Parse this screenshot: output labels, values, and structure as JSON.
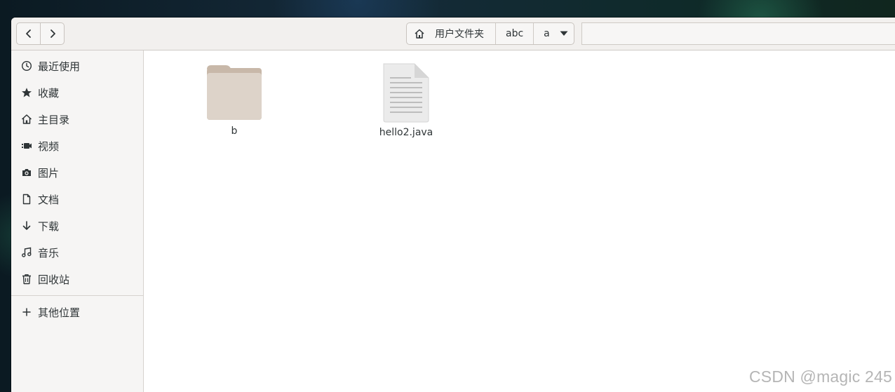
{
  "nav": {
    "back_icon": "chevron-left-icon",
    "forward_icon": "chevron-right-icon"
  },
  "pathbar": {
    "home_label": "用户文件夹",
    "crumbs": [
      "abc",
      "a"
    ]
  },
  "sidebar": {
    "items": [
      {
        "label": "最近使用",
        "icon": "clock-icon"
      },
      {
        "label": "收藏",
        "icon": "star-icon"
      },
      {
        "label": "主目录",
        "icon": "home-icon"
      },
      {
        "label": "视频",
        "icon": "video-icon"
      },
      {
        "label": "图片",
        "icon": "camera-icon"
      },
      {
        "label": "文档",
        "icon": "document-icon"
      },
      {
        "label": "下载",
        "icon": "download-icon"
      },
      {
        "label": "音乐",
        "icon": "music-icon"
      },
      {
        "label": "回收站",
        "icon": "trash-icon"
      },
      {
        "label": "其他位置",
        "icon": "plus-icon"
      }
    ]
  },
  "files": [
    {
      "name": "b",
      "type": "folder"
    },
    {
      "name": "hello2.java",
      "type": "text-file"
    }
  ],
  "watermark": "CSDN @magic 245",
  "colors": {
    "folder": "#ddd3c9",
    "folder_tab": "#c8b8a9"
  }
}
